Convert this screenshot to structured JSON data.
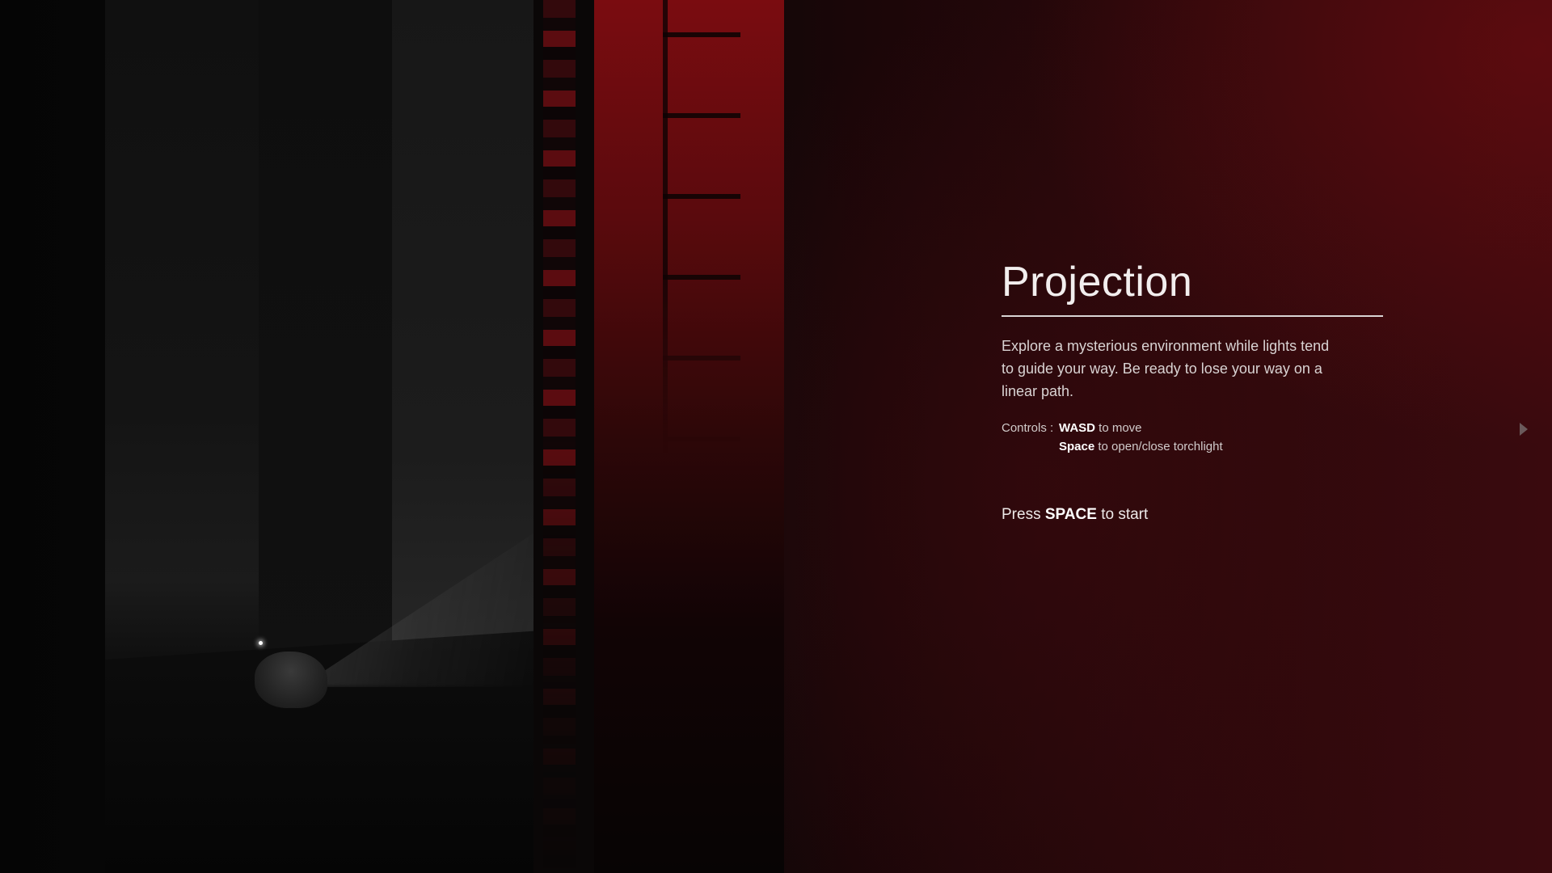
{
  "game": {
    "title": "Projection",
    "description": "Explore a mysterious environment while lights tend to guide your way. Be ready to lose your way on a linear path.",
    "controls_label": "Controls :",
    "controls": [
      {
        "key": "WASD",
        "action": "to move"
      },
      {
        "key": "Space",
        "action": "to open/close torchlight"
      }
    ],
    "start_prefix": "Press",
    "start_key": "SPACE",
    "start_suffix": "to start"
  },
  "icons": {
    "next": "next-arrow-icon"
  },
  "colors": {
    "accent_red": "#7a0c10",
    "background": "#0b0304",
    "text": "#e6e1e1"
  }
}
